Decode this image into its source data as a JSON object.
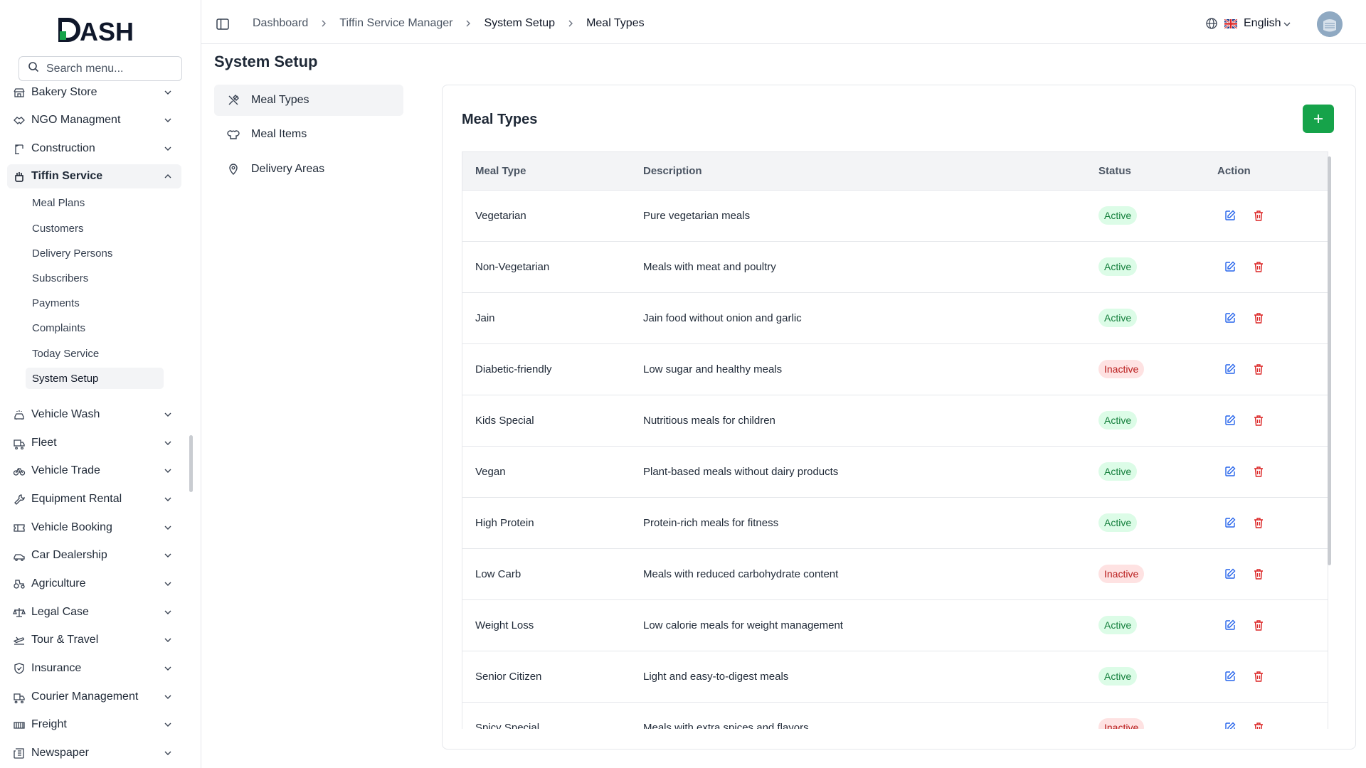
{
  "brand": {
    "logo_text": "DASH"
  },
  "search": {
    "placeholder": "Search menu..."
  },
  "sidebar": {
    "items": [
      {
        "label": "Bakery Store",
        "icon": "store-icon"
      },
      {
        "label": "NGO Managment",
        "icon": "handshake-icon"
      },
      {
        "label": "Construction",
        "icon": "crane-icon"
      },
      {
        "label": "Tiffin Service",
        "icon": "tiffin-icon",
        "expanded": true
      },
      {
        "label": "Vehicle Wash",
        "icon": "car-wash-icon"
      },
      {
        "label": "Fleet",
        "icon": "truck-icon"
      },
      {
        "label": "Vehicle Trade",
        "icon": "bike-icon"
      },
      {
        "label": "Equipment Rental",
        "icon": "wrench-icon"
      },
      {
        "label": "Vehicle Booking",
        "icon": "ticket-icon"
      },
      {
        "label": "Car Dealership",
        "icon": "car-icon"
      },
      {
        "label": "Agriculture",
        "icon": "tractor-icon"
      },
      {
        "label": "Legal Case",
        "icon": "scale-icon"
      },
      {
        "label": "Tour & Travel",
        "icon": "plane-icon"
      },
      {
        "label": "Insurance",
        "icon": "shield-icon"
      },
      {
        "label": "Courier Management",
        "icon": "delivery-icon"
      },
      {
        "label": "Freight",
        "icon": "container-icon"
      },
      {
        "label": "Newspaper",
        "icon": "newspaper-icon"
      }
    ],
    "tiffin_sub": [
      "Meal Plans",
      "Customers",
      "Delivery Persons",
      "Subscribers",
      "Payments",
      "Complaints",
      "Today Service",
      "System Setup"
    ]
  },
  "header": {
    "breadcrumb": [
      "Dashboard",
      "Tiffin Service Manager",
      "System Setup",
      "Meal Types"
    ],
    "language": "English"
  },
  "page": {
    "title": "System Setup"
  },
  "subnav": [
    {
      "label": "Meal Types",
      "icon": "utensils-icon"
    },
    {
      "label": "Meal Items",
      "icon": "chef-hat-icon"
    },
    {
      "label": "Delivery Areas",
      "icon": "map-pin-icon"
    }
  ],
  "card": {
    "title": "Meal Types"
  },
  "table": {
    "headers": [
      "Meal Type",
      "Description",
      "Status",
      "Action"
    ],
    "rows": [
      {
        "name": "Vegetarian",
        "description": "Pure vegetarian meals",
        "status": "Active"
      },
      {
        "name": "Non-Vegetarian",
        "description": "Meals with meat and poultry",
        "status": "Active"
      },
      {
        "name": "Jain",
        "description": "Jain food without onion and garlic",
        "status": "Active"
      },
      {
        "name": "Diabetic-friendly",
        "description": "Low sugar and healthy meals",
        "status": "Inactive"
      },
      {
        "name": "Kids Special",
        "description": "Nutritious meals for children",
        "status": "Active"
      },
      {
        "name": "Vegan",
        "description": "Plant-based meals without dairy products",
        "status": "Active"
      },
      {
        "name": "High Protein",
        "description": "Protein-rich meals for fitness",
        "status": "Active"
      },
      {
        "name": "Low Carb",
        "description": "Meals with reduced carbohydrate content",
        "status": "Inactive"
      },
      {
        "name": "Weight Loss",
        "description": "Low calorie meals for weight management",
        "status": "Active"
      },
      {
        "name": "Senior Citizen",
        "description": "Light and easy-to-digest meals",
        "status": "Active"
      },
      {
        "name": "Spicy Special",
        "description": "Meals with extra spices and flavors",
        "status": "Inactive"
      }
    ]
  },
  "colors": {
    "accent": "#16a34a",
    "active_bg": "#dcfce7",
    "inactive_bg": "#fee2e2",
    "edit": "#2563eb",
    "delete": "#dc2626"
  }
}
